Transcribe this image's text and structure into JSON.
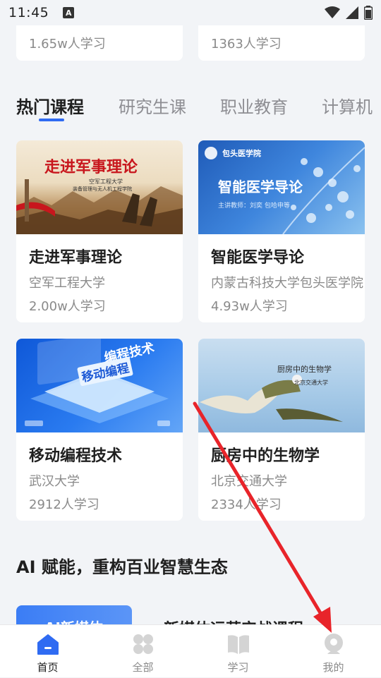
{
  "status_bar": {
    "time": "11:45",
    "notification_icon": "A"
  },
  "top_cards": [
    {
      "learners": "1.65w人学习"
    },
    {
      "learners": "1363人学习"
    }
  ],
  "tabs": [
    "热门课程",
    "研究生课",
    "职业教育",
    "计算机"
  ],
  "courses": [
    {
      "title": "走进军事理论",
      "school": "空军工程大学",
      "learners": "2.00w人学习",
      "cover": {
        "headline": "走进军事理论",
        "sub1": "空军工程大学",
        "sub2": "装备管理与无人机工程学院"
      }
    },
    {
      "title": "智能医学导论",
      "school": "内蒙古科技大学包头医学院",
      "learners": "4.93w人学习",
      "cover": {
        "brand": "包头医学院",
        "headline": "智能医学导论",
        "sub1": "主讲教师：刘奕 包哈申等"
      }
    },
    {
      "title": "移动编程技术",
      "school": "武汉大学",
      "learners": "2912人学习",
      "cover": {
        "headline": "编程技术",
        "badge": "移动编程"
      }
    },
    {
      "title": "厨房中的生物学",
      "school": "北京交通大学",
      "learners": "2334人学习",
      "cover": {
        "headline": "厨房中的生物学",
        "sub1": "北京交通大学"
      }
    }
  ],
  "section_title": "AI 赋能，重构百业智慧生态",
  "ai_card_label": "AI新媒体",
  "ai_text": "新媒体运营实战课程",
  "bottom_nav": [
    {
      "label": "首页",
      "icon": "home-icon"
    },
    {
      "label": "全部",
      "icon": "grid-icon"
    },
    {
      "label": "学习",
      "icon": "book-icon"
    },
    {
      "label": "我的",
      "icon": "profile-icon"
    }
  ],
  "colors": {
    "accent": "#2f6bf2",
    "annotation_arrow": "#e8242a"
  }
}
